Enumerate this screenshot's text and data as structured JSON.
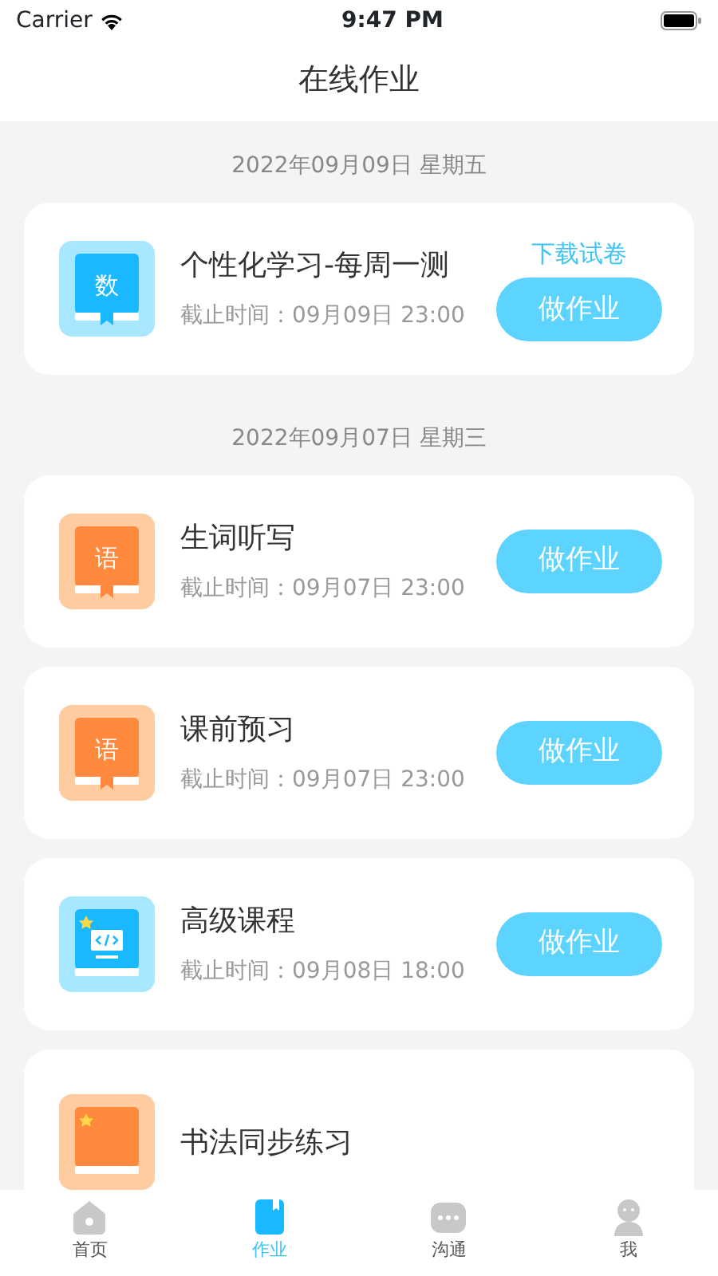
{
  "status_bar": {
    "carrier": "Carrier",
    "time": "9:47 PM"
  },
  "title": "在线作业",
  "groups": [
    {
      "date": "2022年09月09日 星期五",
      "items": [
        {
          "kind": "book",
          "icon_text": "数",
          "color": "#1ab8ff",
          "title": "个性化学习-每周一测",
          "deadline": "截止时间：09月09日 23:00",
          "link": "下载试卷",
          "button": "做作业"
        }
      ]
    },
    {
      "date": "2022年09月07日 星期三",
      "items": [
        {
          "kind": "book",
          "icon_text": "语",
          "color": "#ff8a3d",
          "title": "生词听写",
          "deadline": "截止时间：09月07日 23:00",
          "button": "做作业"
        },
        {
          "kind": "book",
          "icon_text": "语",
          "color": "#ff8a3d",
          "title": "课前预习",
          "deadline": "截止时间：09月07日 23:00",
          "button": "做作业"
        },
        {
          "kind": "code",
          "color": "#1ab8ff",
          "title": "高级课程",
          "deadline": "截止时间：09月08日 18:00",
          "button": "做作业"
        },
        {
          "kind": "star",
          "color": "#ff8a3d",
          "title": "书法同步练习"
        }
      ]
    }
  ],
  "tabs": [
    {
      "label": "首页",
      "kind": "home",
      "selected": false
    },
    {
      "label": "作业",
      "kind": "homework",
      "selected": true
    },
    {
      "label": "沟通",
      "kind": "chat",
      "selected": false
    },
    {
      "label": "我",
      "kind": "me",
      "selected": false
    }
  ]
}
